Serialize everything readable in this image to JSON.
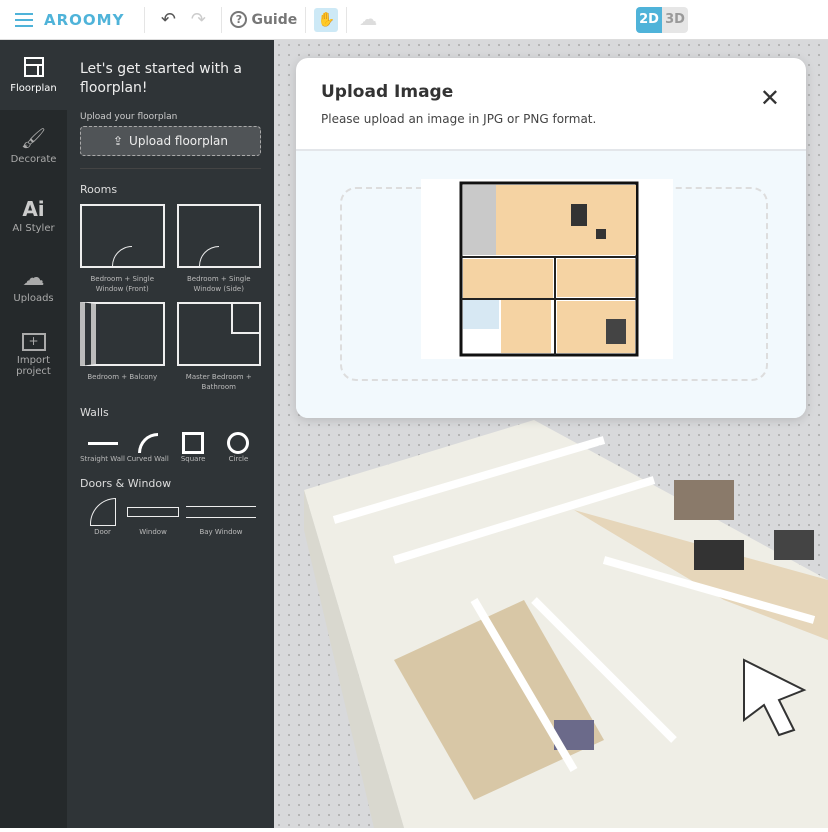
{
  "toolbar": {
    "logo": "AROOMY",
    "guide": "Guide",
    "mode_2d": "2D",
    "mode_3d": "3D",
    "icons": [
      "menu-icon",
      "undo-icon",
      "redo-icon",
      "help-icon",
      "hand-icon",
      "cloud-save-icon"
    ]
  },
  "rail": [
    {
      "label": "Floorplan",
      "icon": "floorplan-icon"
    },
    {
      "label": "Decorate",
      "icon": "paint-roller-icon"
    },
    {
      "label": "AI Styler",
      "icon": "ai-icon"
    },
    {
      "label": "Uploads",
      "icon": "cloud-upload-icon"
    },
    {
      "label": "Import project",
      "icon": "folder-plus-icon"
    }
  ],
  "panel": {
    "heading": "Let's get started with a floorplan!",
    "upload_label": "Upload your floorplan",
    "upload_button": "Upload floorplan",
    "rooms_title": "Rooms",
    "rooms": [
      "Bedroom + Single Window (Front)",
      "Bedroom + Single Window (Side)",
      "Bedroom + Balcony",
      "Master Bedroom + Bathroom"
    ],
    "walls_title": "Walls",
    "walls": [
      "Straight Wall",
      "Curved Wall",
      "Square",
      "Circle"
    ],
    "doors_title": "Doors & Window",
    "doors": [
      "Door",
      "Window",
      "Bay Window"
    ]
  },
  "modal": {
    "title": "Upload Image",
    "subtitle": "Please upload an image in JPG or PNG format."
  },
  "colors": {
    "accent": "#4fb3d9",
    "rail": "#25292b",
    "panel": "#2f3437"
  }
}
